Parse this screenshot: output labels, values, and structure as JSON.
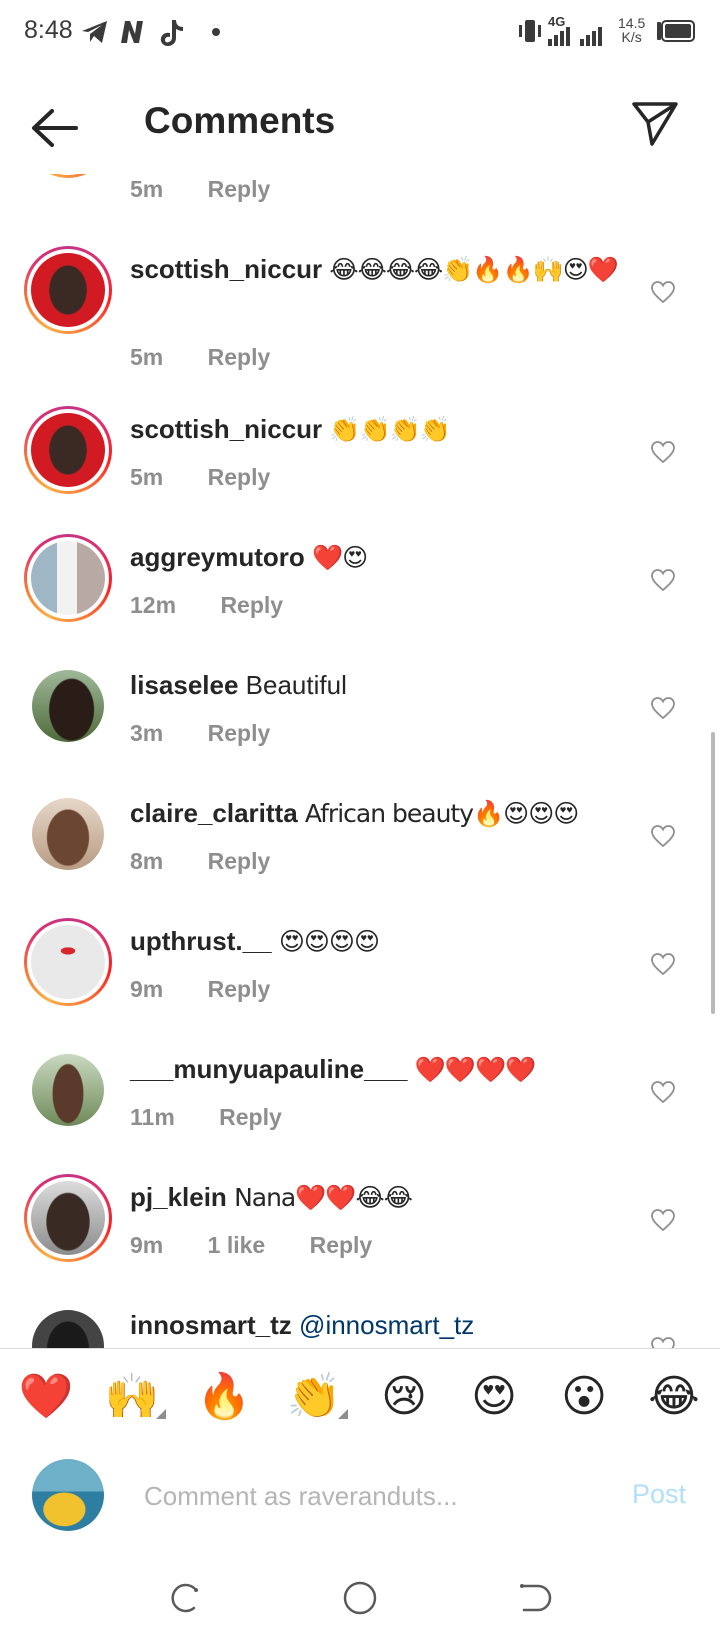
{
  "status_bar": {
    "time": "8:48",
    "network": "4G",
    "speed_value": "14.5",
    "speed_unit": "K/s",
    "icons": [
      "telegram-icon",
      "n-app-icon",
      "tiktok-icon",
      "dot-icon",
      "vibrate-icon",
      "signal-icon",
      "battery-icon"
    ]
  },
  "header": {
    "title": "Comments"
  },
  "comments": [
    {
      "username": "",
      "text": "",
      "time": "5m",
      "reply": "Reply"
    },
    {
      "username": "scottish_niccur",
      "text": "😂😂😂😂👏🔥🔥🙌😍❤️",
      "time": "5m",
      "reply": "Reply"
    },
    {
      "username": "scottish_niccur",
      "text": "👏👏👏👏",
      "time": "5m",
      "reply": "Reply"
    },
    {
      "username": "aggreymutoro",
      "text": "❤️😍",
      "time": "12m",
      "reply": "Reply"
    },
    {
      "username": "lisaselee",
      "text": "Beautiful",
      "time": "3m",
      "reply": "Reply"
    },
    {
      "username": "claire_claritta",
      "text": "African beauty🔥😍😍😍",
      "time": "8m",
      "reply": "Reply"
    },
    {
      "username": "upthrust.__",
      "text": "😍😍😍😍",
      "time": "9m",
      "reply": "Reply"
    },
    {
      "username": "___munyuapauline___",
      "text": "❤️❤️❤️❤️",
      "time": "11m",
      "reply": "Reply"
    },
    {
      "username": "pj_klein",
      "text": "Nana❤️❤️😂😂",
      "time": "9m",
      "likes": "1 like",
      "reply": "Reply"
    },
    {
      "username": "innosmart_tz",
      "text": "@innosmart_tz",
      "time": "",
      "reply": ""
    }
  ],
  "quick_emojis": [
    "❤️",
    "🙌",
    "🔥",
    "👏",
    "😢",
    "😍",
    "😮",
    "😂"
  ],
  "composer": {
    "placeholder": "Comment as raveranduts...",
    "post_label": "Post"
  },
  "navigation": [
    "recents-button",
    "home-button",
    "back-button"
  ]
}
